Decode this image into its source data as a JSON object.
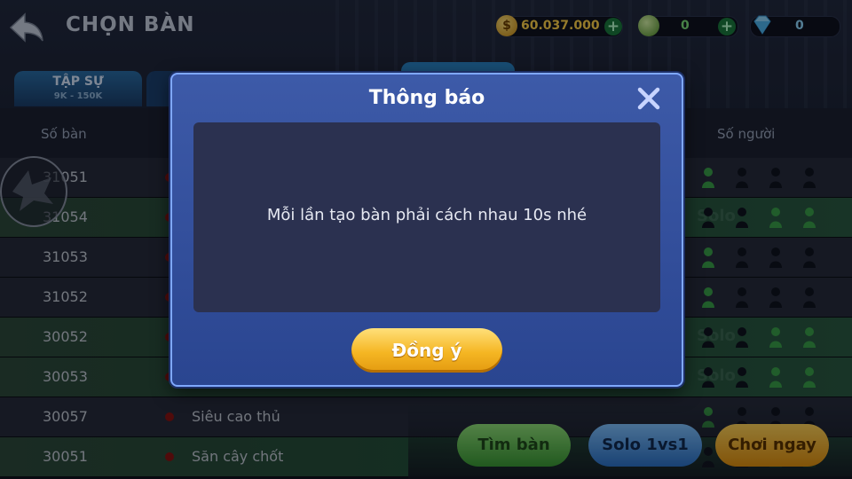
{
  "header": {
    "title": "CHỌN BÀN",
    "coins": "60.037.000",
    "chips": "0",
    "diamonds": "0"
  },
  "tabs": [
    {
      "label": "TẬP SỰ",
      "range": "9K - 150K"
    }
  ],
  "table": {
    "col_id": "Số bàn",
    "col_players": "Số người",
    "rows": [
      {
        "id": "31051",
        "name": "",
        "style": "dark"
      },
      {
        "id": "31054",
        "name": "",
        "style": "green"
      },
      {
        "id": "31053",
        "name": "",
        "style": "dark"
      },
      {
        "id": "31052",
        "name": "",
        "style": "dark"
      },
      {
        "id": "30052",
        "name": "",
        "style": "green"
      },
      {
        "id": "30053",
        "name": "",
        "style": "green"
      },
      {
        "id": "30057",
        "name": "Siêu cao thủ",
        "style": "dark"
      },
      {
        "id": "30051",
        "name": "Săn cây chốt",
        "style": "green"
      }
    ]
  },
  "buttons": {
    "find": "Tìm bàn",
    "solo": "Solo 1vs1",
    "play": "Chơi ngay"
  },
  "dialog": {
    "title": "Thông báo",
    "message": "Mỗi lần tạo bàn phải cách nhau 10s nhé",
    "ok": "Đồng ý"
  },
  "colors": {
    "dialog_bg": "#3d5aa8",
    "ok_button": "#f5b623",
    "green_row": "#24503b"
  }
}
